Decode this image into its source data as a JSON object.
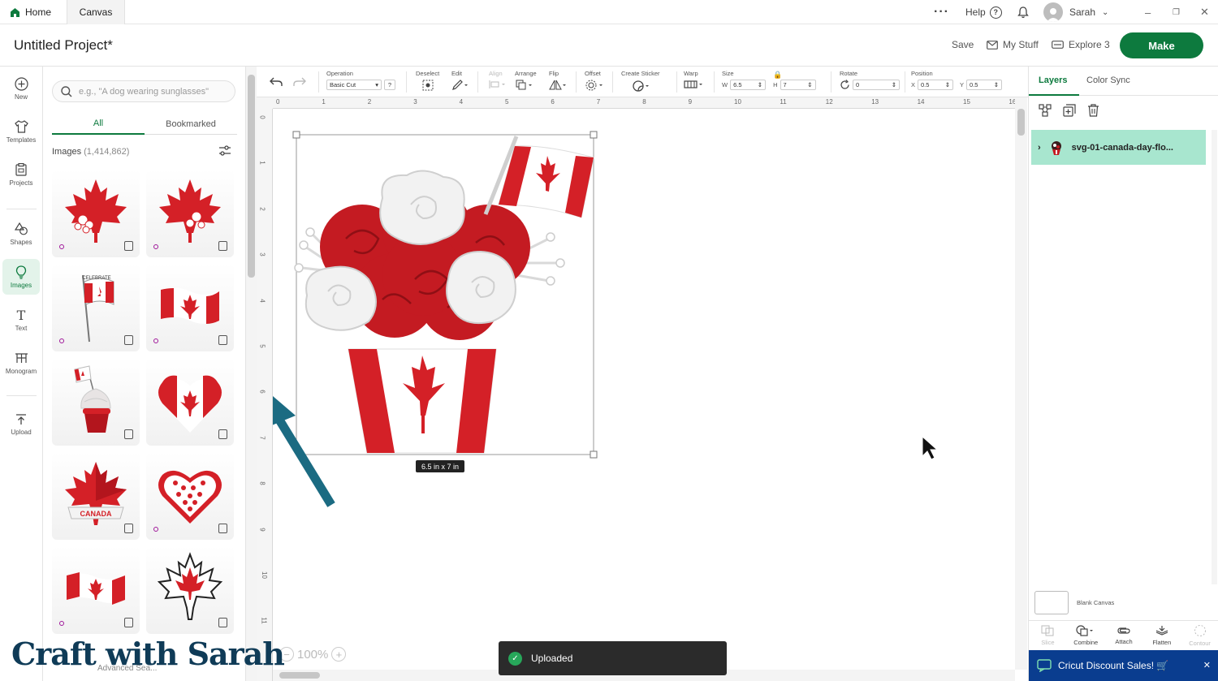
{
  "titlebar": {
    "tabs": [
      "Home",
      "Canvas"
    ],
    "help": "Help",
    "user": "Sarah",
    "more_icon": "more-icon",
    "bell_icon": "bell-icon"
  },
  "header": {
    "project_title": "Untitled Project*",
    "save": "Save",
    "my_stuff": "My Stuff",
    "machine": "Explore 3",
    "make": "Make"
  },
  "leftnav": {
    "items": [
      "New",
      "Templates",
      "Projects",
      "Shapes",
      "Images",
      "Text",
      "Monogram",
      "Upload"
    ]
  },
  "panel": {
    "search_placeholder": "e.g., \"A dog wearing sunglasses\"",
    "tabs": [
      "All",
      "Bookmarked"
    ],
    "images_label": "Images",
    "images_count": "(1,414,862)",
    "cards": [
      {
        "desc": "maple-leaf-floral"
      },
      {
        "desc": "maple-leaf-floral-2"
      },
      {
        "desc": "celebrate-flag",
        "text": "CELEBRATE"
      },
      {
        "desc": "canada-flag-wave"
      },
      {
        "desc": "cupcake-flag"
      },
      {
        "desc": "heart-flag"
      },
      {
        "desc": "maple-leaf-banner",
        "text": "CANADA"
      },
      {
        "desc": "heart-maple-pattern"
      },
      {
        "desc": "canada-flag-simple"
      },
      {
        "desc": "maple-leaf-outline"
      }
    ]
  },
  "toolbar": {
    "operation_label": "Operation",
    "operation_value": "Basic Cut",
    "help_q": "?",
    "deselect": "Deselect",
    "edit": "Edit",
    "align": "Align",
    "arrange": "Arrange",
    "flip": "Flip",
    "offset": "Offset",
    "create_sticker": "Create Sticker",
    "warp": "Warp",
    "size_label": "Size",
    "w_label": "W",
    "w_value": "6.5",
    "h_label": "H",
    "h_value": "7",
    "rotate_label": "Rotate",
    "rotate_value": "0",
    "position_label": "Position",
    "x_label": "X",
    "x_value": "0.5",
    "y_label": "Y",
    "y_value": "0.5"
  },
  "rulers": {
    "top": [
      "0",
      "1",
      "2",
      "3",
      "4",
      "5",
      "6",
      "7",
      "8",
      "9",
      "10",
      "11",
      "12",
      "13",
      "14",
      "15",
      "16"
    ],
    "left": [
      "0",
      "1",
      "2",
      "3",
      "4",
      "5",
      "6",
      "7",
      "8",
      "9",
      "10",
      "11"
    ]
  },
  "canvas": {
    "size_badge": "6.5  in x 7  in",
    "zoom": "100%",
    "toast": "Uploaded"
  },
  "rightpanel": {
    "tabs": [
      "Layers",
      "Color Sync"
    ],
    "layer_name": "svg-01-canada-day-flo...",
    "blank_canvas": "Blank Canvas",
    "actions": [
      "Slice",
      "Combine",
      "Attach",
      "Flatten",
      "Contour"
    ],
    "promo": "Cricut Discount Sales! 🛒"
  },
  "watermark": {
    "text": "Craft with Sarah",
    "sub": "Advanced Sea..."
  },
  "colors": {
    "brand_green": "#0d7a3e",
    "flag_red": "#d42027",
    "layer_highlight": "#a8e6cf",
    "promo_blue": "#0a3d8f",
    "arrow_teal": "#1b6b82"
  }
}
